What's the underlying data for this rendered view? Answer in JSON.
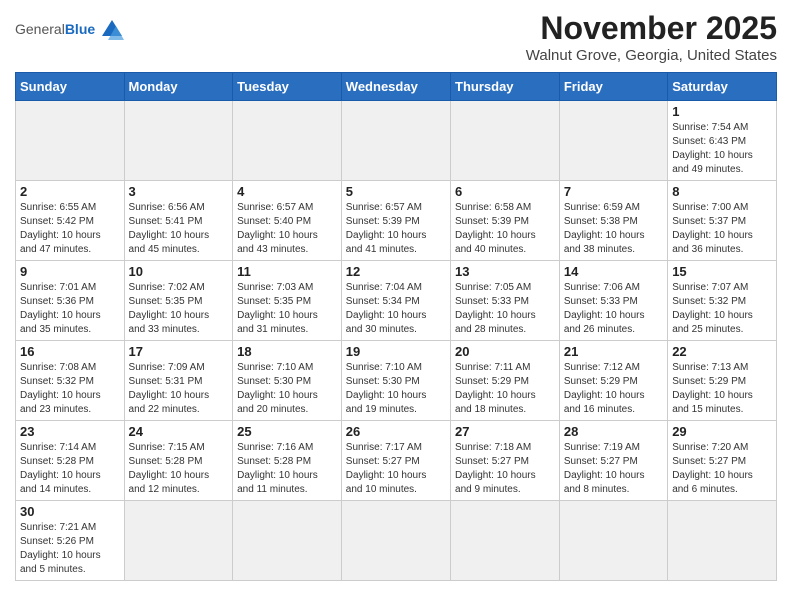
{
  "header": {
    "logo_line1": "General",
    "logo_line2": "Blue",
    "month": "November 2025",
    "location": "Walnut Grove, Georgia, United States"
  },
  "days_of_week": [
    "Sunday",
    "Monday",
    "Tuesday",
    "Wednesday",
    "Thursday",
    "Friday",
    "Saturday"
  ],
  "weeks": [
    [
      {
        "day": "",
        "info": ""
      },
      {
        "day": "",
        "info": ""
      },
      {
        "day": "",
        "info": ""
      },
      {
        "day": "",
        "info": ""
      },
      {
        "day": "",
        "info": ""
      },
      {
        "day": "",
        "info": ""
      },
      {
        "day": "1",
        "info": "Sunrise: 7:54 AM\nSunset: 6:43 PM\nDaylight: 10 hours\nand 49 minutes."
      }
    ],
    [
      {
        "day": "2",
        "info": "Sunrise: 6:55 AM\nSunset: 5:42 PM\nDaylight: 10 hours\nand 47 minutes."
      },
      {
        "day": "3",
        "info": "Sunrise: 6:56 AM\nSunset: 5:41 PM\nDaylight: 10 hours\nand 45 minutes."
      },
      {
        "day": "4",
        "info": "Sunrise: 6:57 AM\nSunset: 5:40 PM\nDaylight: 10 hours\nand 43 minutes."
      },
      {
        "day": "5",
        "info": "Sunrise: 6:57 AM\nSunset: 5:39 PM\nDaylight: 10 hours\nand 41 minutes."
      },
      {
        "day": "6",
        "info": "Sunrise: 6:58 AM\nSunset: 5:39 PM\nDaylight: 10 hours\nand 40 minutes."
      },
      {
        "day": "7",
        "info": "Sunrise: 6:59 AM\nSunset: 5:38 PM\nDaylight: 10 hours\nand 38 minutes."
      },
      {
        "day": "8",
        "info": "Sunrise: 7:00 AM\nSunset: 5:37 PM\nDaylight: 10 hours\nand 36 minutes."
      }
    ],
    [
      {
        "day": "9",
        "info": "Sunrise: 7:01 AM\nSunset: 5:36 PM\nDaylight: 10 hours\nand 35 minutes."
      },
      {
        "day": "10",
        "info": "Sunrise: 7:02 AM\nSunset: 5:35 PM\nDaylight: 10 hours\nand 33 minutes."
      },
      {
        "day": "11",
        "info": "Sunrise: 7:03 AM\nSunset: 5:35 PM\nDaylight: 10 hours\nand 31 minutes."
      },
      {
        "day": "12",
        "info": "Sunrise: 7:04 AM\nSunset: 5:34 PM\nDaylight: 10 hours\nand 30 minutes."
      },
      {
        "day": "13",
        "info": "Sunrise: 7:05 AM\nSunset: 5:33 PM\nDaylight: 10 hours\nand 28 minutes."
      },
      {
        "day": "14",
        "info": "Sunrise: 7:06 AM\nSunset: 5:33 PM\nDaylight: 10 hours\nand 26 minutes."
      },
      {
        "day": "15",
        "info": "Sunrise: 7:07 AM\nSunset: 5:32 PM\nDaylight: 10 hours\nand 25 minutes."
      }
    ],
    [
      {
        "day": "16",
        "info": "Sunrise: 7:08 AM\nSunset: 5:32 PM\nDaylight: 10 hours\nand 23 minutes."
      },
      {
        "day": "17",
        "info": "Sunrise: 7:09 AM\nSunset: 5:31 PM\nDaylight: 10 hours\nand 22 minutes."
      },
      {
        "day": "18",
        "info": "Sunrise: 7:10 AM\nSunset: 5:30 PM\nDaylight: 10 hours\nand 20 minutes."
      },
      {
        "day": "19",
        "info": "Sunrise: 7:10 AM\nSunset: 5:30 PM\nDaylight: 10 hours\nand 19 minutes."
      },
      {
        "day": "20",
        "info": "Sunrise: 7:11 AM\nSunset: 5:29 PM\nDaylight: 10 hours\nand 18 minutes."
      },
      {
        "day": "21",
        "info": "Sunrise: 7:12 AM\nSunset: 5:29 PM\nDaylight: 10 hours\nand 16 minutes."
      },
      {
        "day": "22",
        "info": "Sunrise: 7:13 AM\nSunset: 5:29 PM\nDaylight: 10 hours\nand 15 minutes."
      }
    ],
    [
      {
        "day": "23",
        "info": "Sunrise: 7:14 AM\nSunset: 5:28 PM\nDaylight: 10 hours\nand 14 minutes."
      },
      {
        "day": "24",
        "info": "Sunrise: 7:15 AM\nSunset: 5:28 PM\nDaylight: 10 hours\nand 12 minutes."
      },
      {
        "day": "25",
        "info": "Sunrise: 7:16 AM\nSunset: 5:28 PM\nDaylight: 10 hours\nand 11 minutes."
      },
      {
        "day": "26",
        "info": "Sunrise: 7:17 AM\nSunset: 5:27 PM\nDaylight: 10 hours\nand 10 minutes."
      },
      {
        "day": "27",
        "info": "Sunrise: 7:18 AM\nSunset: 5:27 PM\nDaylight: 10 hours\nand 9 minutes."
      },
      {
        "day": "28",
        "info": "Sunrise: 7:19 AM\nSunset: 5:27 PM\nDaylight: 10 hours\nand 8 minutes."
      },
      {
        "day": "29",
        "info": "Sunrise: 7:20 AM\nSunset: 5:27 PM\nDaylight: 10 hours\nand 6 minutes."
      }
    ],
    [
      {
        "day": "30",
        "info": "Sunrise: 7:21 AM\nSunset: 5:26 PM\nDaylight: 10 hours\nand 5 minutes."
      },
      {
        "day": "",
        "info": ""
      },
      {
        "day": "",
        "info": ""
      },
      {
        "day": "",
        "info": ""
      },
      {
        "day": "",
        "info": ""
      },
      {
        "day": "",
        "info": ""
      },
      {
        "day": "",
        "info": ""
      }
    ]
  ]
}
